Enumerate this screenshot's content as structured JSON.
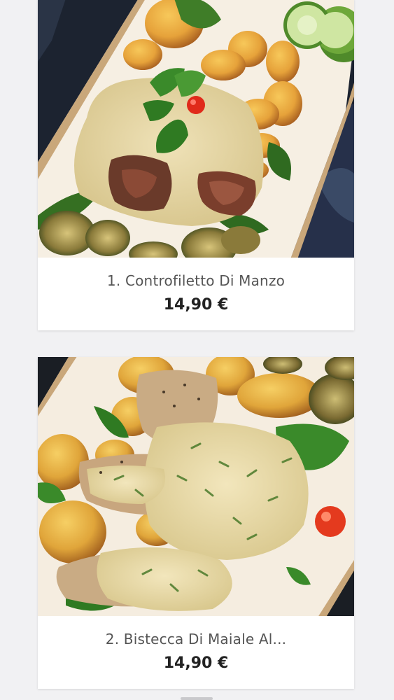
{
  "menu": {
    "items": [
      {
        "name": "1. Controfiletto Di Manzo",
        "price": "14,90 €",
        "photo_icon": "beef-sirloin-dish-photo"
      },
      {
        "name": "2. Bistecca Di Maiale Al...",
        "price": "14,90 €",
        "photo_icon": "pork-steak-dish-photo"
      }
    ]
  },
  "colors": {
    "page_background": "#f1f1f3",
    "card_background": "#ffffff",
    "name_text": "#555555",
    "price_text": "#222222"
  }
}
